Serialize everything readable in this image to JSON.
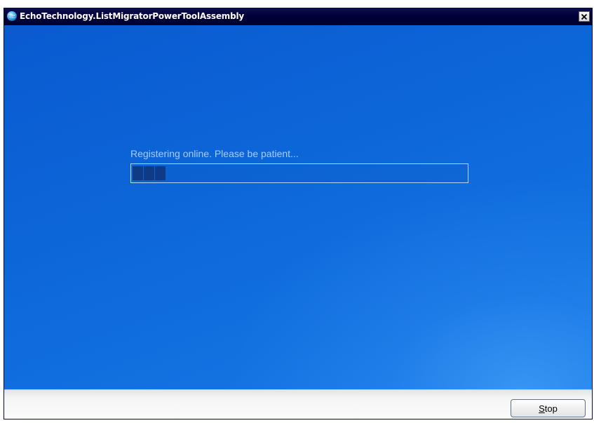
{
  "window": {
    "title": "EchoTechnology.ListMigratorPowerToolAssembly",
    "icon": "app-globe-icon",
    "close_icon": "close-icon"
  },
  "main": {
    "status_text": "Registering online. Please be patient...",
    "progress": {
      "filled_blocks": 3,
      "block_color": "#0e3a86"
    },
    "background_color": "#0d66d8"
  },
  "footer": {
    "stop_button": {
      "mnemonic": "S",
      "rest": "top",
      "label": "Stop"
    }
  }
}
